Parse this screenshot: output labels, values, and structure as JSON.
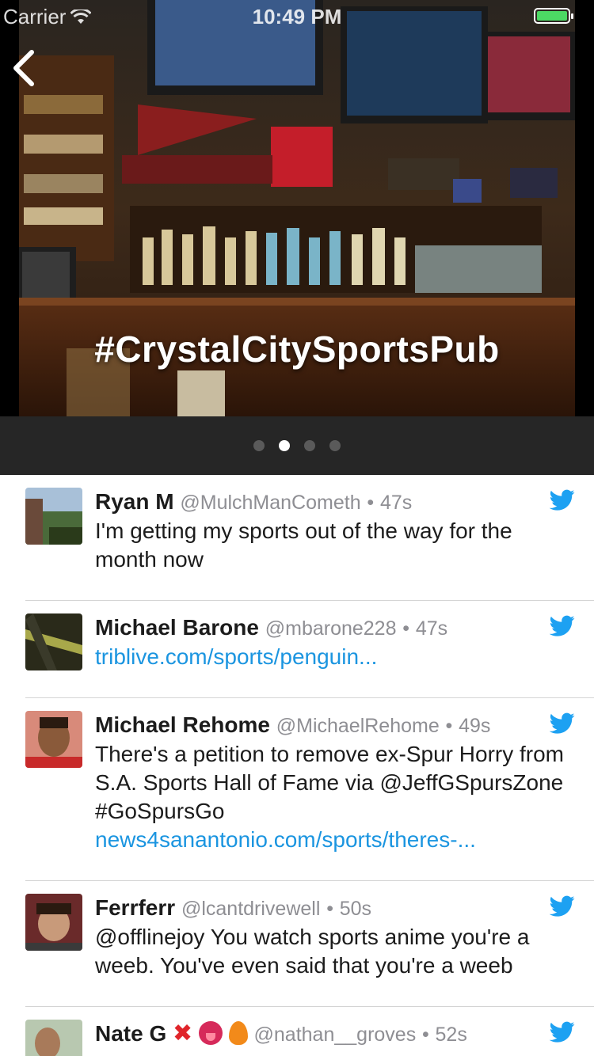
{
  "status_bar": {
    "carrier": "Carrier",
    "time": "10:49 PM",
    "battery_level": 1.0
  },
  "hero": {
    "hashtag": "#CrystalCitySportsPub"
  },
  "pager": {
    "count": 4,
    "active_index": 1
  },
  "tweets": [
    {
      "name": "Ryan M",
      "handle": "@MulchManCometh",
      "time": "47s",
      "text": "I'm getting my sports out of the way for the month now",
      "link": "",
      "emoji": []
    },
    {
      "name": "Michael Barone",
      "handle": "@mbarone228",
      "time": "47s",
      "text": "",
      "link": "triblive.com/sports/penguin...",
      "emoji": []
    },
    {
      "name": "Michael Rehome",
      "handle": "@MichaelRehome",
      "time": "49s",
      "text": "There's a petition to remove ex-Spur Horry from S.A. Sports Hall of Fame via @JeffGSpursZone #GoSpursGo",
      "link": "news4sanantonio.com/sports/theres-...",
      "emoji": []
    },
    {
      "name": "Ferrferr",
      "handle": "@lcantdrivewell",
      "time": "50s",
      "text": "@offlinejoy You watch sports anime you're a weeb. You've even said that you're a weeb",
      "link": "",
      "emoji": []
    },
    {
      "name": "Nate G",
      "handle": "@nathan__groves",
      "time": "52s",
      "text": "",
      "link": "",
      "emoji": [
        "cross-mark-emoji",
        "tongue-face-emoji",
        "fire-emoji"
      ]
    }
  ],
  "icons": {
    "twitter_bird": "twitter-bird-icon",
    "back": "chevron-left-icon",
    "wifi": "wifi-icon",
    "battery": "battery-icon"
  },
  "colors": {
    "link": "#1b95e0",
    "twitter_blue": "#1da1f2",
    "pager_bg": "#262626",
    "battery_green": "#4cd964"
  }
}
